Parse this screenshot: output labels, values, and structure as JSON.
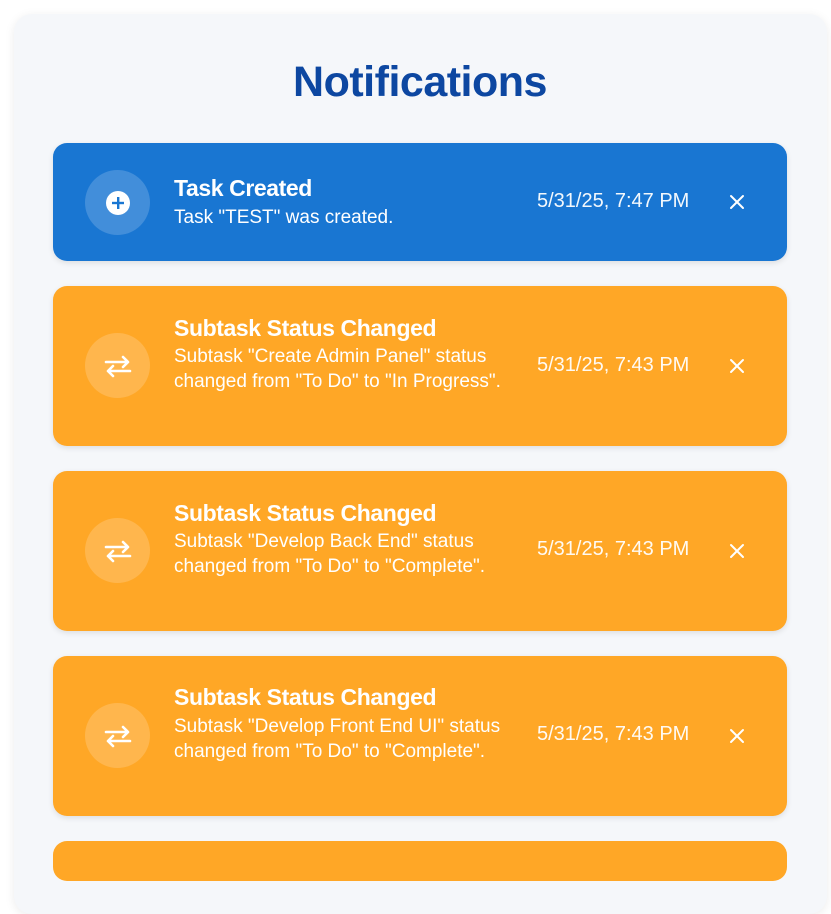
{
  "page": {
    "title": "Notifications"
  },
  "notifications": [
    {
      "type": "created",
      "icon": "plus-circle-icon",
      "title": "Task Created",
      "message": "Task \"TEST\" was created.",
      "time": "5/31/25, 7:47 PM",
      "color": "#1976d2"
    },
    {
      "type": "status",
      "icon": "swap-arrows-icon",
      "title": "Subtask Status Changed",
      "message": "Subtask \"Create Admin Panel\" status changed from \"To Do\" to \"In Progress\".",
      "time": "5/31/25, 7:43 PM",
      "color": "#ffa726"
    },
    {
      "type": "status",
      "icon": "swap-arrows-icon",
      "title": "Subtask Status Changed",
      "message": "Subtask \"Develop Back End\" status changed from \"To Do\" to \"Complete\".",
      "time": "5/31/25, 7:43 PM",
      "color": "#ffa726"
    },
    {
      "type": "status",
      "icon": "swap-arrows-icon",
      "title": "Subtask Status Changed",
      "message": "Subtask \"Develop Front End UI\" status changed from \"To Do\" to \"Complete\".",
      "time": "5/31/25, 7:43 PM",
      "color": "#ffa726"
    }
  ],
  "colors": {
    "title": "#0d47a1",
    "panel_bg": "#f5f7fa"
  }
}
